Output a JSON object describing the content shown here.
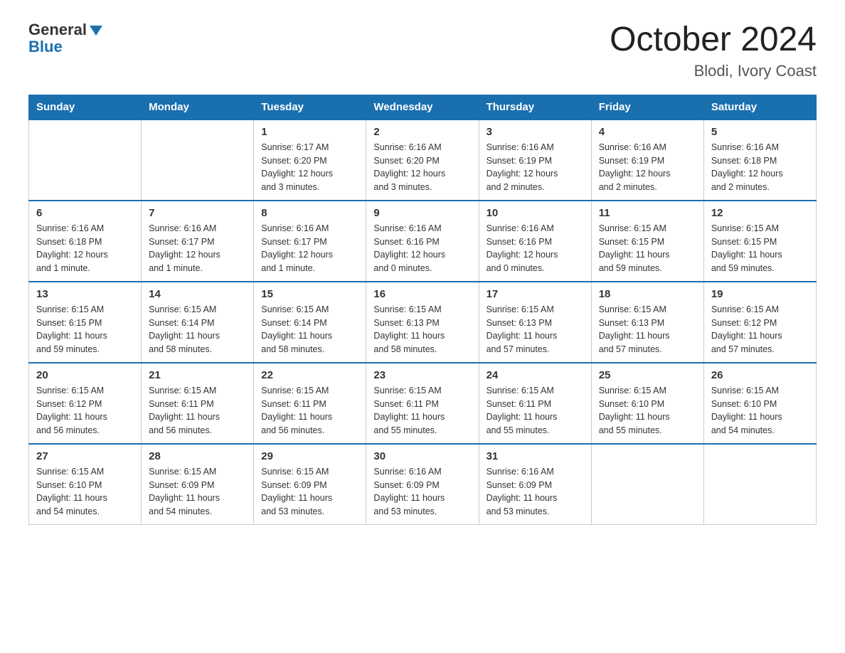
{
  "logo": {
    "general": "General",
    "blue": "Blue",
    "triangle": "▲"
  },
  "title": {
    "month_year": "October 2024",
    "location": "Blodi, Ivory Coast"
  },
  "weekdays": [
    "Sunday",
    "Monday",
    "Tuesday",
    "Wednesday",
    "Thursday",
    "Friday",
    "Saturday"
  ],
  "weeks": [
    [
      {
        "day": "",
        "info": ""
      },
      {
        "day": "",
        "info": ""
      },
      {
        "day": "1",
        "info": "Sunrise: 6:17 AM\nSunset: 6:20 PM\nDaylight: 12 hours\nand 3 minutes."
      },
      {
        "day": "2",
        "info": "Sunrise: 6:16 AM\nSunset: 6:20 PM\nDaylight: 12 hours\nand 3 minutes."
      },
      {
        "day": "3",
        "info": "Sunrise: 6:16 AM\nSunset: 6:19 PM\nDaylight: 12 hours\nand 2 minutes."
      },
      {
        "day": "4",
        "info": "Sunrise: 6:16 AM\nSunset: 6:19 PM\nDaylight: 12 hours\nand 2 minutes."
      },
      {
        "day": "5",
        "info": "Sunrise: 6:16 AM\nSunset: 6:18 PM\nDaylight: 12 hours\nand 2 minutes."
      }
    ],
    [
      {
        "day": "6",
        "info": "Sunrise: 6:16 AM\nSunset: 6:18 PM\nDaylight: 12 hours\nand 1 minute."
      },
      {
        "day": "7",
        "info": "Sunrise: 6:16 AM\nSunset: 6:17 PM\nDaylight: 12 hours\nand 1 minute."
      },
      {
        "day": "8",
        "info": "Sunrise: 6:16 AM\nSunset: 6:17 PM\nDaylight: 12 hours\nand 1 minute."
      },
      {
        "day": "9",
        "info": "Sunrise: 6:16 AM\nSunset: 6:16 PM\nDaylight: 12 hours\nand 0 minutes."
      },
      {
        "day": "10",
        "info": "Sunrise: 6:16 AM\nSunset: 6:16 PM\nDaylight: 12 hours\nand 0 minutes."
      },
      {
        "day": "11",
        "info": "Sunrise: 6:15 AM\nSunset: 6:15 PM\nDaylight: 11 hours\nand 59 minutes."
      },
      {
        "day": "12",
        "info": "Sunrise: 6:15 AM\nSunset: 6:15 PM\nDaylight: 11 hours\nand 59 minutes."
      }
    ],
    [
      {
        "day": "13",
        "info": "Sunrise: 6:15 AM\nSunset: 6:15 PM\nDaylight: 11 hours\nand 59 minutes."
      },
      {
        "day": "14",
        "info": "Sunrise: 6:15 AM\nSunset: 6:14 PM\nDaylight: 11 hours\nand 58 minutes."
      },
      {
        "day": "15",
        "info": "Sunrise: 6:15 AM\nSunset: 6:14 PM\nDaylight: 11 hours\nand 58 minutes."
      },
      {
        "day": "16",
        "info": "Sunrise: 6:15 AM\nSunset: 6:13 PM\nDaylight: 11 hours\nand 58 minutes."
      },
      {
        "day": "17",
        "info": "Sunrise: 6:15 AM\nSunset: 6:13 PM\nDaylight: 11 hours\nand 57 minutes."
      },
      {
        "day": "18",
        "info": "Sunrise: 6:15 AM\nSunset: 6:13 PM\nDaylight: 11 hours\nand 57 minutes."
      },
      {
        "day": "19",
        "info": "Sunrise: 6:15 AM\nSunset: 6:12 PM\nDaylight: 11 hours\nand 57 minutes."
      }
    ],
    [
      {
        "day": "20",
        "info": "Sunrise: 6:15 AM\nSunset: 6:12 PM\nDaylight: 11 hours\nand 56 minutes."
      },
      {
        "day": "21",
        "info": "Sunrise: 6:15 AM\nSunset: 6:11 PM\nDaylight: 11 hours\nand 56 minutes."
      },
      {
        "day": "22",
        "info": "Sunrise: 6:15 AM\nSunset: 6:11 PM\nDaylight: 11 hours\nand 56 minutes."
      },
      {
        "day": "23",
        "info": "Sunrise: 6:15 AM\nSunset: 6:11 PM\nDaylight: 11 hours\nand 55 minutes."
      },
      {
        "day": "24",
        "info": "Sunrise: 6:15 AM\nSunset: 6:11 PM\nDaylight: 11 hours\nand 55 minutes."
      },
      {
        "day": "25",
        "info": "Sunrise: 6:15 AM\nSunset: 6:10 PM\nDaylight: 11 hours\nand 55 minutes."
      },
      {
        "day": "26",
        "info": "Sunrise: 6:15 AM\nSunset: 6:10 PM\nDaylight: 11 hours\nand 54 minutes."
      }
    ],
    [
      {
        "day": "27",
        "info": "Sunrise: 6:15 AM\nSunset: 6:10 PM\nDaylight: 11 hours\nand 54 minutes."
      },
      {
        "day": "28",
        "info": "Sunrise: 6:15 AM\nSunset: 6:09 PM\nDaylight: 11 hours\nand 54 minutes."
      },
      {
        "day": "29",
        "info": "Sunrise: 6:15 AM\nSunset: 6:09 PM\nDaylight: 11 hours\nand 53 minutes."
      },
      {
        "day": "30",
        "info": "Sunrise: 6:16 AM\nSunset: 6:09 PM\nDaylight: 11 hours\nand 53 minutes."
      },
      {
        "day": "31",
        "info": "Sunrise: 6:16 AM\nSunset: 6:09 PM\nDaylight: 11 hours\nand 53 minutes."
      },
      {
        "day": "",
        "info": ""
      },
      {
        "day": "",
        "info": ""
      }
    ]
  ]
}
